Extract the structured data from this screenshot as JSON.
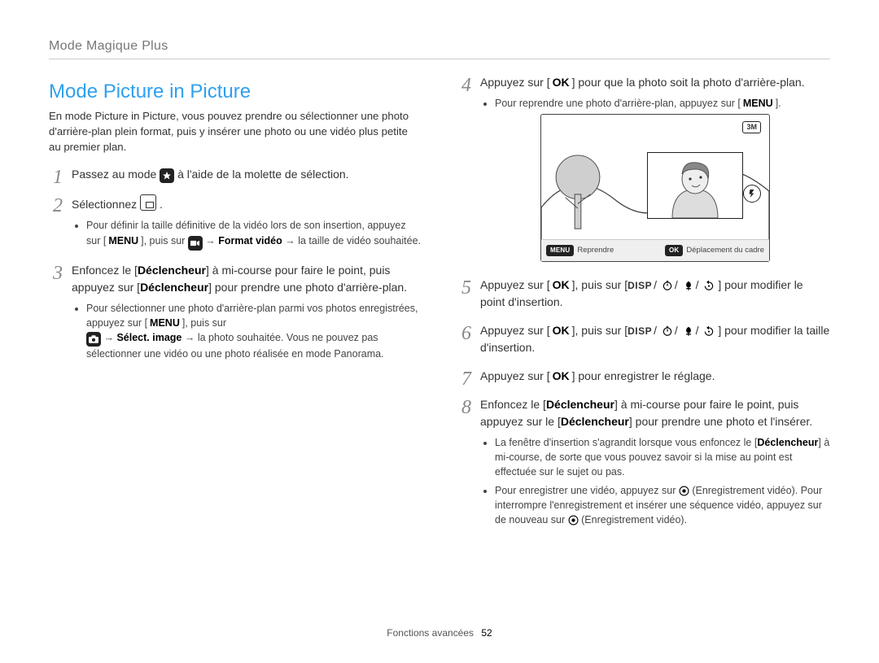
{
  "header": {
    "breadcrumb": "Mode Magique Plus"
  },
  "title": "Mode Picture in Picture",
  "intro": "En mode Picture in Picture, vous pouvez prendre ou sélectionner une photo d'arrière-plan plein format, puis y insérer une photo ou une vidéo plus petite au premier plan.",
  "left": {
    "step1": {
      "num": "1",
      "text_pre": "Passez au mode ",
      "text_post": " à l'aide de la molette de sélection."
    },
    "step2": {
      "num": "2",
      "text_pre": "Sélectionnez ",
      "text_post": ".",
      "sub1_pre": "Pour définir la taille définitive de la vidéo lors de son insertion, appuyez sur [",
      "sub1_menu": "MENU",
      "sub1_mid": "], puis sur ",
      "sub1_arrow1": " → ",
      "sub1_fv": "Format vidéo",
      "sub1_arrow2": " → la taille de vidéo souhaitée."
    },
    "step3": {
      "num": "3",
      "text": "Enfoncez le [Déclencheur] à mi-course pour faire le point, puis appuyez sur [Déclencheur] pour prendre une photo d'arrière-plan.",
      "sub1_pre": "Pour sélectionner une photo d'arrière-plan parmi vos photos enregistrées, appuyez sur [",
      "sub1_menu": "MENU",
      "sub1_mid": "], puis sur",
      "sub2_pre": " → ",
      "sub2_sel": "Sélect. image",
      "sub2_post": " → la photo souhaitée. Vous ne pouvez pas sélectionner une vidéo ou une photo réalisée en mode Panorama."
    }
  },
  "right": {
    "step4": {
      "num": "4",
      "text_pre": "Appuyez sur [",
      "ok": "OK",
      "text_post": "] pour que la photo soit la photo d'arrière-plan.",
      "sub1_pre": "Pour reprendre une photo d'arrière-plan, appuyez sur [",
      "sub1_menu": "MENU",
      "sub1_post": "]."
    },
    "preview": {
      "badge": "3M",
      "footer_left_pill": "MENU",
      "footer_left": "Reprendre",
      "footer_right_pill": "OK",
      "footer_right": "Déplacement du cadre"
    },
    "step5": {
      "num": "5",
      "pre": "Appuyez sur [",
      "ok": "OK",
      "mid": "], puis sur [",
      "disp": "DISP",
      "post": "] pour modifier le point d'insertion."
    },
    "step6": {
      "num": "6",
      "pre": "Appuyez sur [",
      "ok": "OK",
      "mid": "], puis sur [",
      "disp": "DISP",
      "post": "] pour modifier la taille d'insertion."
    },
    "step7": {
      "num": "7",
      "pre": "Appuyez sur [",
      "ok": "OK",
      "post": "] pour enregistrer le réglage."
    },
    "step8": {
      "num": "8",
      "text": "Enfoncez le [Déclencheur] à mi-course pour faire le point, puis appuyez sur le [Déclencheur] pour prendre une photo et l'insérer.",
      "sub1": "La fenêtre d'insertion s'agrandit lorsque vous enfoncez le [Déclencheur] à mi-course, de sorte que vous pouvez savoir si la mise au point est effectuée sur le sujet ou pas.",
      "sub2_pre": "Pour enregistrer une vidéo, appuyez sur ",
      "sub2_mid": " (Enregistrement vidéo). Pour interrompre l'enregistrement et insérer une séquence vidéo, appuyez sur de nouveau sur ",
      "sub2_post": " (Enregistrement vidéo)."
    }
  },
  "footer": {
    "section": "Fonctions avancées",
    "page": "52"
  }
}
